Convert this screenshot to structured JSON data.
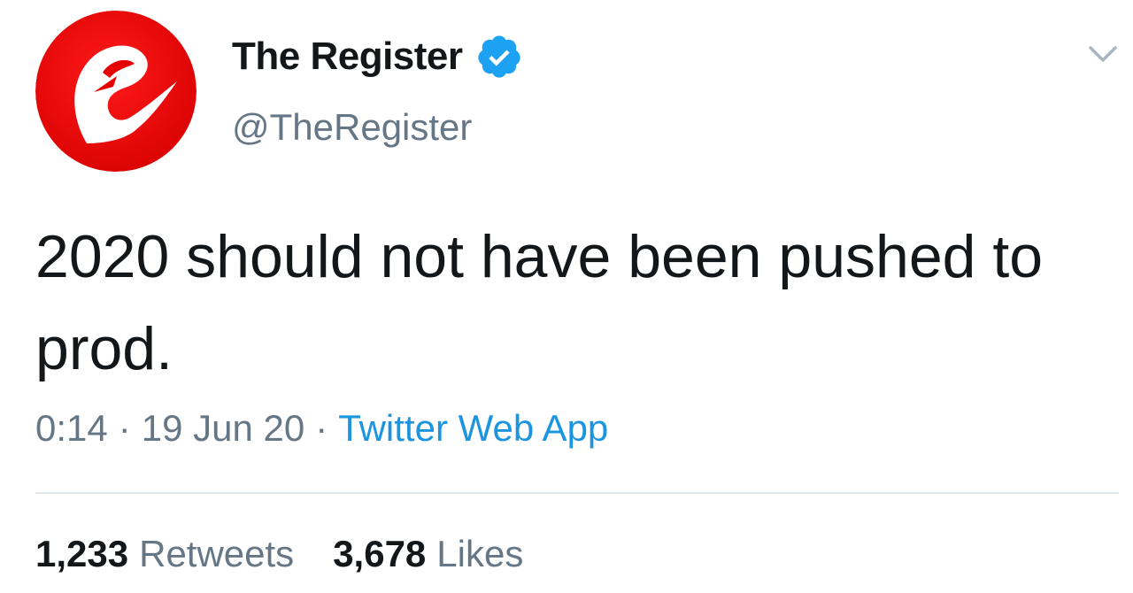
{
  "profile": {
    "display_name": "The Register",
    "handle": "@TheRegister",
    "verified": true,
    "avatar_icon": "register-logo-icon",
    "avatar_color": "#e60000"
  },
  "tweet": {
    "text": "2020 should not have been pushed to prod.",
    "time": "0:14",
    "date": "19 Jun 20",
    "separator": "·",
    "source": "Twitter Web App"
  },
  "stats": {
    "retweets_count": "1,233",
    "retweets_label": "Retweets",
    "likes_count": "3,678",
    "likes_label": "Likes"
  },
  "colors": {
    "text_primary": "#14171a",
    "text_secondary": "#657786",
    "link": "#1b95e0",
    "verified_badge": "#1da1f2",
    "divider": "#e1e8ed"
  },
  "icons": {
    "verified": "verified-badge-icon",
    "menu": "chevron-down-icon"
  }
}
